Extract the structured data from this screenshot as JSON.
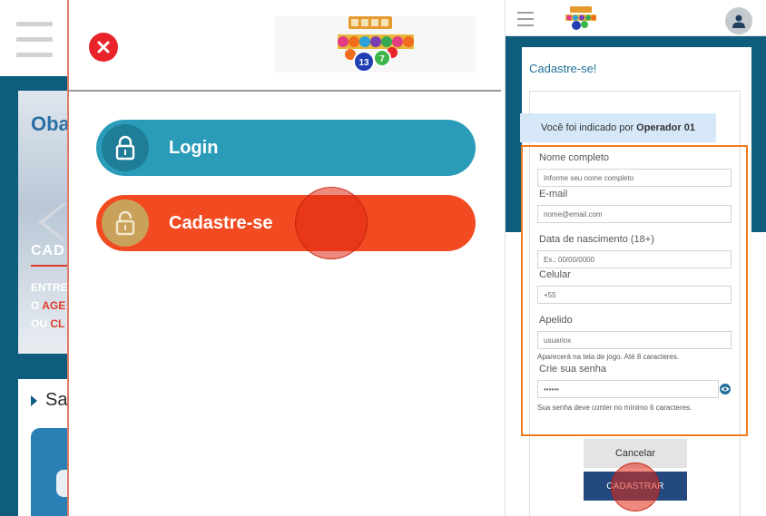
{
  "background_app": {
    "banner_logo": "Oba",
    "banner_title": "CAD",
    "banner_lines": [
      {
        "white": "ENTRE",
        "red": ""
      },
      {
        "white": "O ",
        "red": "AGE"
      },
      {
        "white": "OU ",
        "red": "CL"
      }
    ],
    "section_title": "Sa"
  },
  "menu": {
    "login_label": "Login",
    "signup_label": "Cadastre-se",
    "logo_numbers": [
      "13",
      "7"
    ]
  },
  "form": {
    "title": "Cadastre-se!",
    "referral_prefix": "Você foi indicado por",
    "referral_name": "Operador 01",
    "fields": {
      "full_name": {
        "label": "Nome completo",
        "placeholder": "Informe seu nome completo"
      },
      "email": {
        "label": "E-mail",
        "placeholder": "nome@email.com"
      },
      "birthdate": {
        "label": "Data de nascimento (18+)",
        "placeholder": "Ex.: 00/00/0000"
      },
      "phone": {
        "label": "Celular",
        "value": "+55"
      },
      "nickname": {
        "label": "Apelido",
        "placeholder": "usuariox",
        "hint": "Aparecerá na tela de jogo. Até 8 caracteres."
      },
      "password": {
        "label": "Crie sua senha",
        "value": "••••••",
        "hint": "Sua senha deve conter no mínimo 6 caracteres."
      }
    },
    "cancel_label": "Cancelar",
    "submit_label": "CADASTRAR"
  },
  "colors": {
    "brand_blue": "#0f5d7c",
    "login_button": "#2a9bb8",
    "signup_button": "#f24b22",
    "submit_button": "#24497f",
    "highlight_border": "#f07b1e",
    "close_red": "#e8232a"
  },
  "icons": [
    "hamburger-icon",
    "close-icon",
    "lock-icon",
    "unlock-icon",
    "user-avatar-icon",
    "eye-icon"
  ]
}
